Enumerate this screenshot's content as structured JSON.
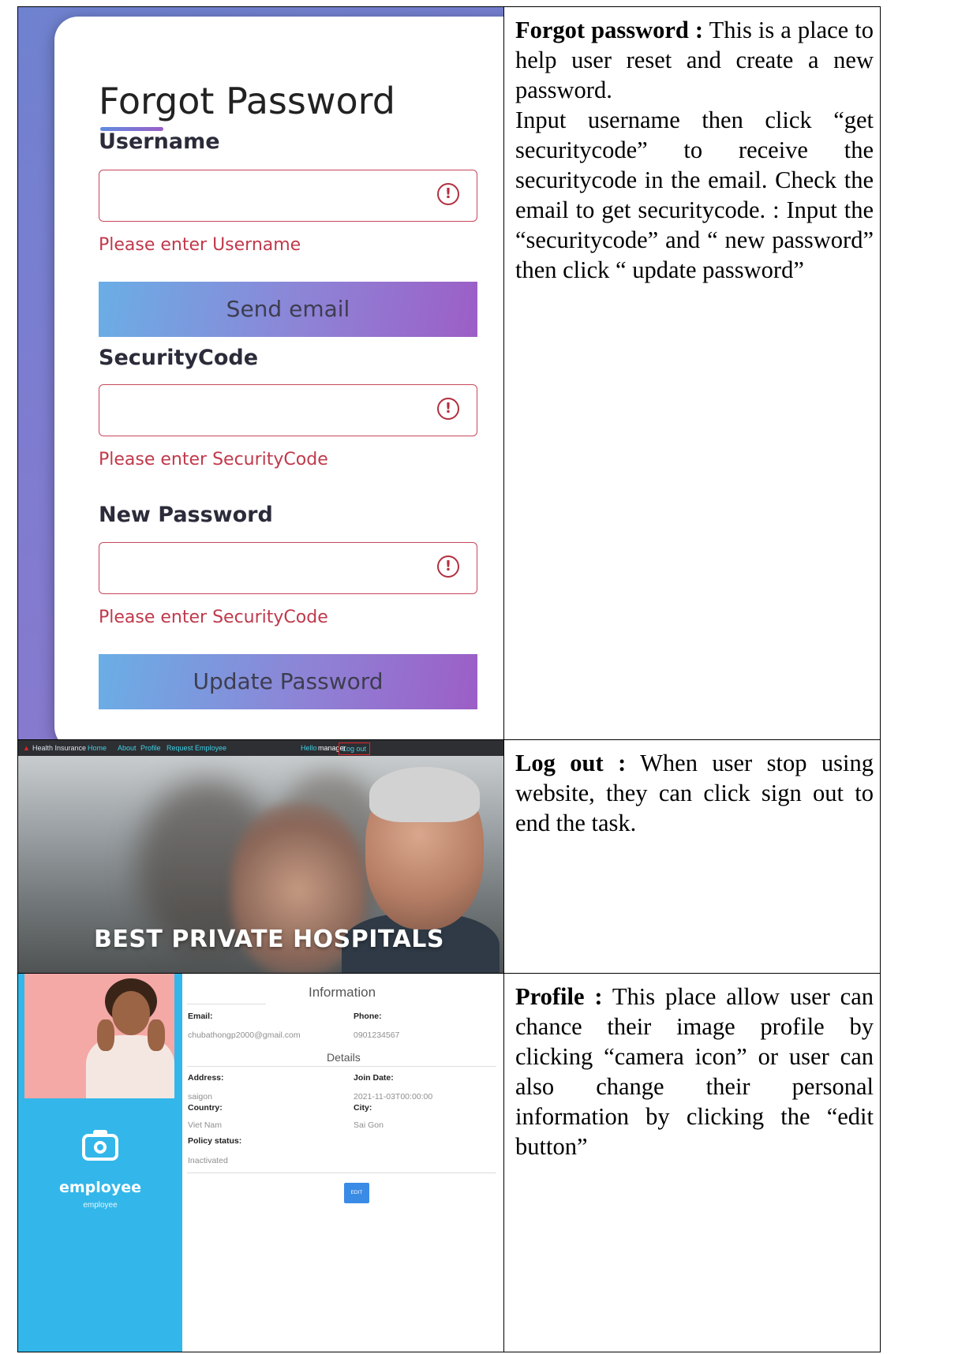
{
  "forgot_password_screen": {
    "title": "Forgot Password",
    "username_label": "Username",
    "username_error": "Please enter Username",
    "send_email_button": "Send email",
    "security_code_label": "SecurityCode",
    "security_code_error": "Please enter SecurityCode",
    "new_password_label": "New Password",
    "new_password_error": "Please enter SecurityCode",
    "update_password_button": "Update Password",
    "alert_icon_glyph": "!"
  },
  "forgot_password_desc": {
    "title": "Forgot password :",
    "line1": " This is a place to help user reset and create a new password.",
    "line2": "Input username then click “get securitycode” to receive the securitycode in the email. Check the email to get securitycode. : Input the “securitycode” and “ new password” then click “ update password”"
  },
  "logout_screen": {
    "brand": "Health Insurance",
    "nav_home": "Home",
    "nav_about": "About",
    "nav_profile": "Profile",
    "nav_request": "Request Employee",
    "hello_text": "Hello",
    "user_name": "manager",
    "logout_link": "Log out",
    "hero_title": "BEST PRIVATE HOSPITALS",
    "highlight_color": "#e2262b"
  },
  "logout_desc": {
    "title": "Log out :",
    "text": " When user stop using website, they can click sign out to end the task."
  },
  "profile_screen": {
    "name": "employee",
    "role": "employee",
    "information_heading": "Information",
    "email_label": "Email:",
    "email_value": "chubathongp2000@gmail.com",
    "phone_label": "Phone:",
    "phone_value": "0901234567",
    "details_heading": "Details",
    "address_label": "Address:",
    "address_value": "saigon",
    "join_date_label": "Join Date:",
    "join_date_value": "2021-11-03T00:00:00",
    "country_label": "Country:",
    "country_value": "Viet Nam",
    "city_label": "City:",
    "city_value": "Sai Gon",
    "policy_status_label": "Policy status:",
    "policy_status_value": "Inactivated",
    "edit_button": "EDIT",
    "sidebar_color": "#33b7ea"
  },
  "profile_desc": {
    "title": "Profile :",
    "text": " This place allow user can chance their image profile by clicking “camera icon” or user can also change their personal information by clicking the “edit button”"
  }
}
